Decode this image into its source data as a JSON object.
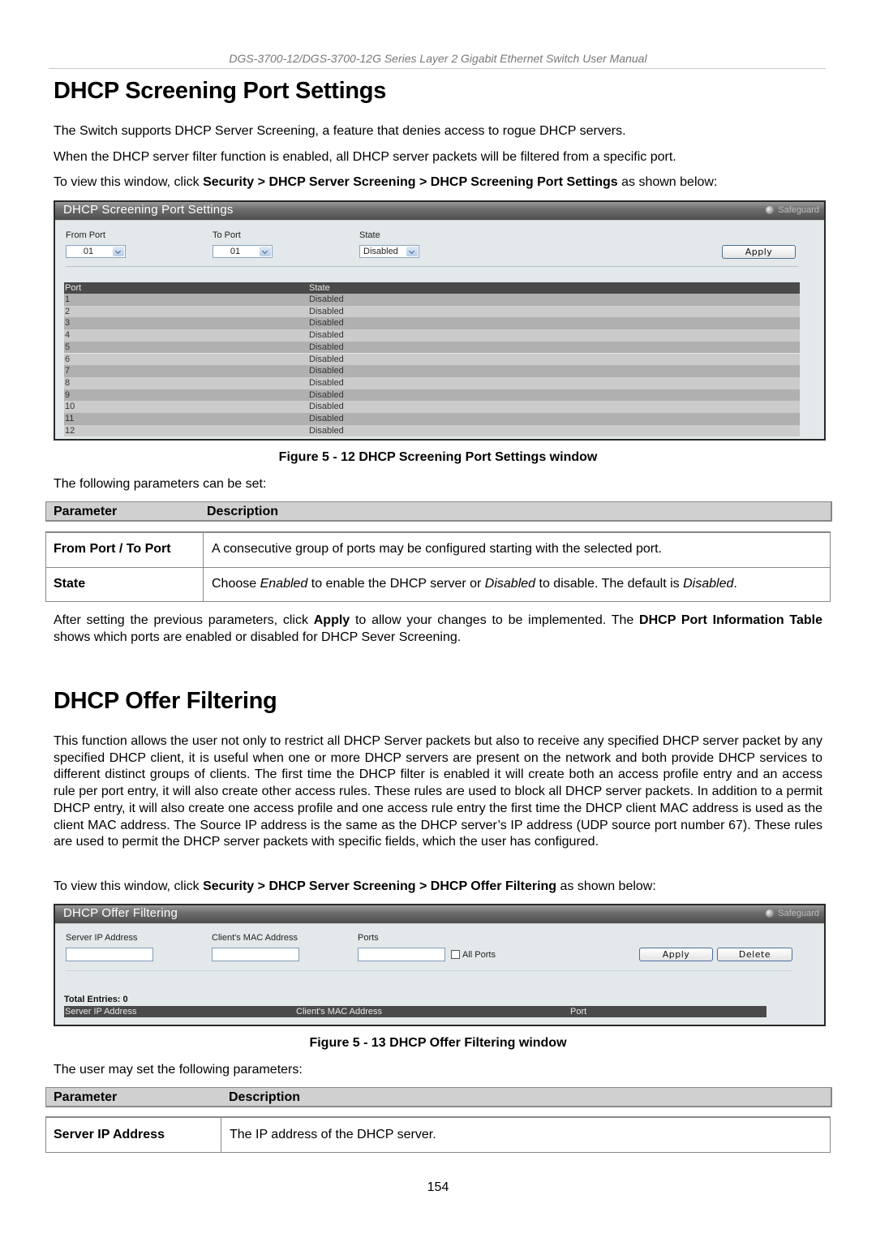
{
  "running_header": "DGS-3700-12/DGS-3700-12G Series Layer 2 Gigabit Ethernet Switch User Manual",
  "section1": {
    "title": "DHCP Screening Port Settings",
    "para1": "The Switch supports DHCP Server Screening, a feature that denies access to rogue DHCP servers.",
    "para2": "When the DHCP server filter function is enabled, all DHCP server packets will be filtered from a specific port.",
    "para3_prefix": "To view this window, click ",
    "para3_path": "Security > DHCP Server Screening > DHCP Screening Port Settings",
    "para3_suffix": " as shown below:",
    "window": {
      "title": "DHCP Screening Port Settings",
      "safeguard": "Safeguard",
      "from_port_label": "From Port",
      "from_port_value": "01",
      "to_port_label": "To Port",
      "to_port_value": "01",
      "state_label": "State",
      "state_value": "Disabled",
      "apply_label": "Apply",
      "table_headers": [
        "Port",
        "State"
      ],
      "rows": [
        {
          "port": "1",
          "state": "Disabled"
        },
        {
          "port": "2",
          "state": "Disabled"
        },
        {
          "port": "3",
          "state": "Disabled"
        },
        {
          "port": "4",
          "state": "Disabled"
        },
        {
          "port": "5",
          "state": "Disabled"
        },
        {
          "port": "6",
          "state": "Disabled"
        },
        {
          "port": "7",
          "state": "Disabled"
        },
        {
          "port": "8",
          "state": "Disabled"
        },
        {
          "port": "9",
          "state": "Disabled"
        },
        {
          "port": "10",
          "state": "Disabled"
        },
        {
          "port": "11",
          "state": "Disabled"
        },
        {
          "port": "12",
          "state": "Disabled"
        }
      ]
    },
    "caption": "Figure 5 - 12 DHCP Screening Port Settings window",
    "params_intro": "The following parameters can be set:",
    "param_table": {
      "header_param": "Parameter",
      "header_desc": "Description",
      "rows": [
        {
          "name": "From Port / To Port",
          "desc": "A consecutive group of ports may be configured starting with the selected port."
        },
        {
          "name": "State",
          "desc_parts": [
            "Choose ",
            "Enabled",
            " to enable the DHCP server or ",
            "Disabled",
            " to disable. The default is ",
            "Disabled",
            "."
          ]
        }
      ]
    },
    "after_para": {
      "p1": "After setting the previous parameters, click ",
      "b1": "Apply",
      "p2": " to allow your changes to be implemented. The ",
      "b2": "DHCP Port Information Table",
      "p3": " shows which ports are enabled or disabled for DHCP Sever Screening."
    }
  },
  "section2": {
    "title": "DHCP Offer Filtering",
    "body": "This function allows the user not only to restrict all DHCP Server packets but also to receive any specified DHCP server packet by any specified DHCP client, it is useful when one or more DHCP servers are present on the network and both provide DHCP services to different distinct groups of clients. The first time the DHCP filter is enabled it will create both an access profile entry and an access rule per port entry, it will also create other access rules. These rules are used to block all DHCP server packets. In addition to a permit DHCP entry, it will also create one access profile and one access rule entry the first time the DHCP client MAC address is used as the client MAC address. The Source IP address is the same as the DHCP server’s IP address (UDP source port number 67). These rules are used to permit the DHCP server packets with specific fields, which the user has configured.",
    "view_prefix": "To view this window, click ",
    "view_path": "Security > DHCP Server Screening > DHCP Offer Filtering",
    "view_suffix": " as shown below:",
    "window": {
      "title": "DHCP Offer Filtering",
      "safeguard": "Safeguard",
      "server_ip_label": "Server IP Address",
      "server_ip_value": "",
      "client_mac_label": "Client's MAC Address",
      "client_mac_value": "",
      "ports_label": "Ports",
      "ports_value": "",
      "all_ports_label": "All Ports",
      "all_ports_checked": false,
      "apply_label": "Apply",
      "delete_label": "Delete",
      "total_entries": "Total Entries: 0",
      "table_headers": [
        "Server IP Address",
        "Client's MAC Address",
        "Port"
      ]
    },
    "caption": "Figure 5 - 13 DHCP Offer Filtering window",
    "params_intro": "The user may set the following parameters:",
    "param_table": {
      "header_param": "Parameter",
      "header_desc": "Description",
      "rows": [
        {
          "name": "Server IP Address",
          "desc": "The IP address of the DHCP server."
        }
      ]
    }
  },
  "page_number": "154"
}
